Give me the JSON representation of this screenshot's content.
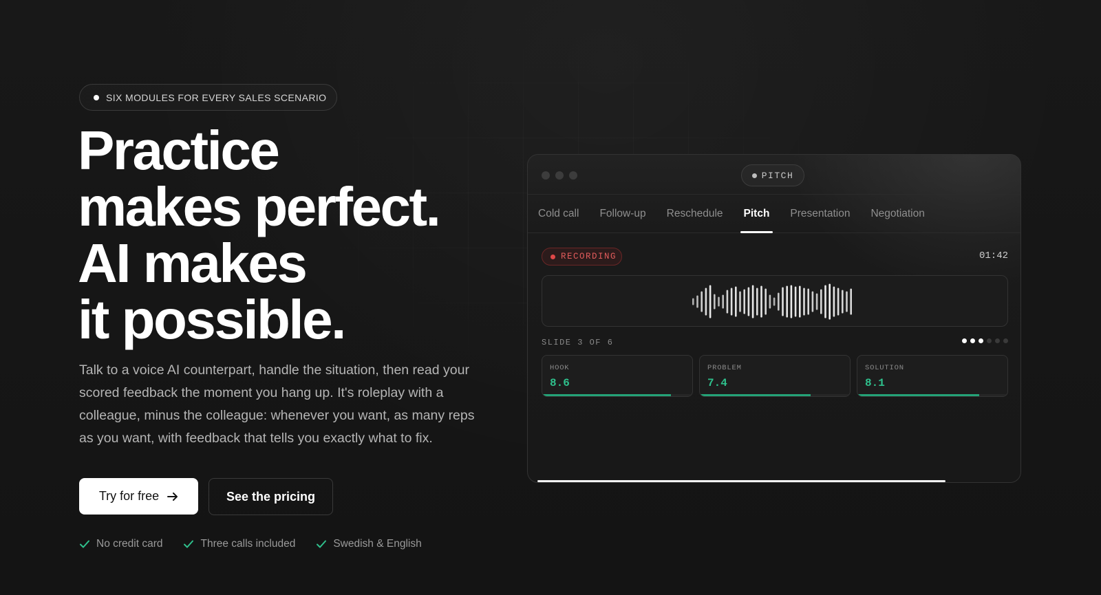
{
  "badge": {
    "label": "SIX MODULES FOR EVERY SALES SCENARIO"
  },
  "hero": {
    "headline": [
      "Practice",
      "makes perfect.",
      "AI makes",
      "it possible."
    ],
    "subtext": "Talk to a voice AI counterpart, handle the situation, then read your scored feedback the moment you hang up. It's roleplay with a colleague, minus the colleague: whenever you want, as many reps as you want, with feedback that tells you exactly what to fix."
  },
  "cta": {
    "primary": {
      "label": "Try for free",
      "icon": "arrow-right-icon"
    },
    "secondary": {
      "label": "See the pricing"
    }
  },
  "features": [
    {
      "label": "No credit card",
      "icon": "check-icon"
    },
    {
      "label": "Three calls included",
      "icon": "check-icon"
    },
    {
      "label": "Swedish & English",
      "icon": "check-icon"
    }
  ],
  "mockup": {
    "chip": "PITCH",
    "tabs": [
      {
        "label": "Cold call",
        "active": false
      },
      {
        "label": "Follow-up",
        "active": false
      },
      {
        "label": "Reschedule",
        "active": false
      },
      {
        "label": "Pitch",
        "active": true
      },
      {
        "label": "Presentation",
        "active": false
      },
      {
        "label": "Negotiation",
        "active": false
      }
    ],
    "recording_label": "RECORDING",
    "timer": "01:42",
    "slide_label": "SLIDE 3 OF 6",
    "slides": {
      "current": 3,
      "total": 6
    },
    "scores": [
      {
        "label": "HOOK",
        "value": "8.6",
        "fill": 0.86
      },
      {
        "label": "PROBLEM",
        "value": "7.4",
        "fill": 0.74
      },
      {
        "label": "SOLUTION",
        "value": "8.1",
        "fill": 0.81
      }
    ],
    "progress": 0.86
  },
  "colors": {
    "accent_green": "#2fc08c",
    "recording_red": "#e15b5b",
    "background": "#151515"
  }
}
